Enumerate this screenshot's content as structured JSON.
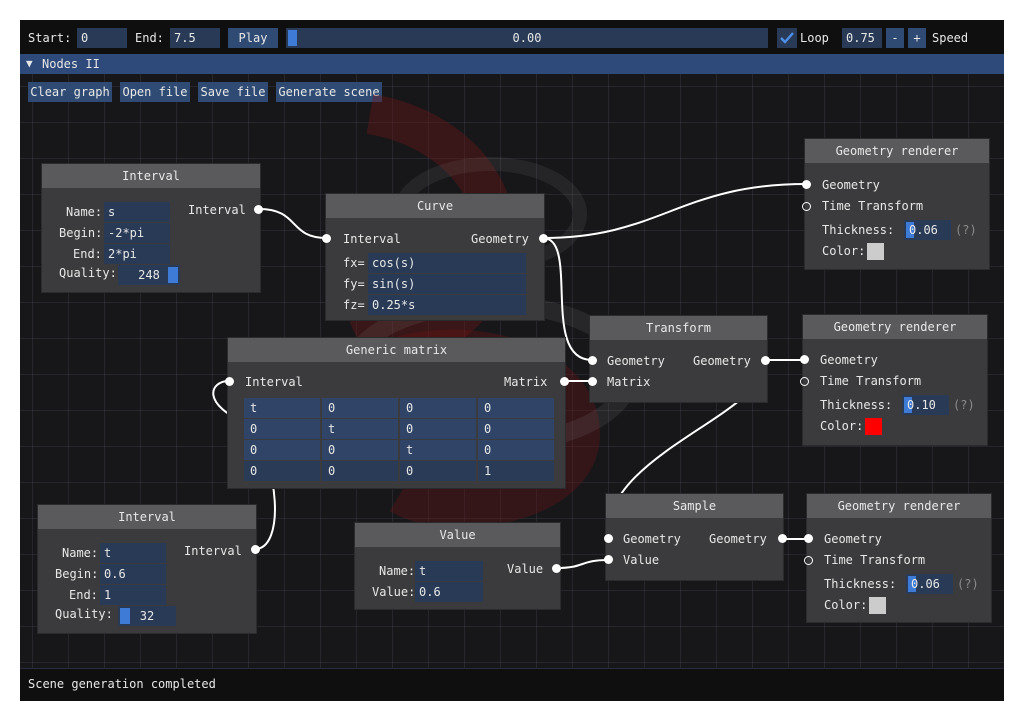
{
  "toolbar": {
    "start_label": "Start:",
    "start_value": "0",
    "end_label": "End:",
    "end_value": "7.5",
    "play_label": "Play",
    "progress_text": "0.00",
    "progress_fraction": 0.0,
    "loop_label": "Loop",
    "loop_checked": true,
    "speed_value": "0.75",
    "minus_label": "-",
    "plus_label": "+",
    "speed_label": "Speed"
  },
  "panel": {
    "header": "Nodes II",
    "buttons": [
      "Clear graph",
      "Open file",
      "Save file",
      "Generate scene"
    ]
  },
  "nodes": {
    "interval1": {
      "title": "Interval",
      "name_label": "Name:",
      "name": "s",
      "begin_label": "Begin:",
      "begin": "-2*pi",
      "end_label": "End:",
      "end": "2*pi",
      "quality_label": "Quality:",
      "quality": "248",
      "out": "Interval"
    },
    "curve": {
      "title": "Curve",
      "in": "Interval",
      "out": "Geometry",
      "fx_label": "fx=",
      "fx": "cos(s)",
      "fy_label": "fy=",
      "fy": "sin(s)",
      "fz_label": "fz=",
      "fz": "0.25*s"
    },
    "matrix": {
      "title": "Generic matrix",
      "in": "Interval",
      "out": "Matrix",
      "rows": [
        [
          "t",
          "0",
          "0",
          "0"
        ],
        [
          "0",
          "t",
          "0",
          "0"
        ],
        [
          "0",
          "0",
          "t",
          "0"
        ],
        [
          "0",
          "0",
          "0",
          "1"
        ]
      ]
    },
    "interval2": {
      "title": "Interval",
      "name_label": "Name:",
      "name": "t",
      "begin_label": "Begin:",
      "begin": "0.6",
      "end_label": "End:",
      "end": "1",
      "quality_label": "Quality:",
      "quality": "32",
      "out": "Interval"
    },
    "value": {
      "title": "Value",
      "name_label": "Name:",
      "name": "t",
      "value_label": "Value:",
      "value": "0.6",
      "out": "Value"
    },
    "transform": {
      "title": "Transform",
      "in1": "Geometry",
      "in2": "Matrix",
      "out": "Geometry"
    },
    "sample": {
      "title": "Sample",
      "in1": "Geometry",
      "in2": "Value",
      "out": "Geometry"
    },
    "renderer1": {
      "title": "Geometry renderer",
      "in1": "Geometry",
      "in2": "Time Transform",
      "thick_label": "Thickness:",
      "thickness": "0.06",
      "help": "(?)",
      "color_label": "Color:",
      "color": "#cccccc"
    },
    "renderer2": {
      "title": "Geometry renderer",
      "in1": "Geometry",
      "in2": "Time Transform",
      "thick_label": "Thickness:",
      "thickness": "0.10",
      "help": "(?)",
      "color_label": "Color:",
      "color": "#ff0000"
    },
    "renderer3": {
      "title": "Geometry renderer",
      "in1": "Geometry",
      "in2": "Time Transform",
      "thick_label": "Thickness:",
      "thickness": "0.06",
      "help": "(?)",
      "color_label": "Color:",
      "color": "#cccccc"
    }
  },
  "status": "Scene generation completed",
  "colors": {
    "accent": "#3d7bd6",
    "node_bg": "#3b3b3d",
    "title_bg": "#5a5a5d",
    "field_bg": "#283a56"
  }
}
